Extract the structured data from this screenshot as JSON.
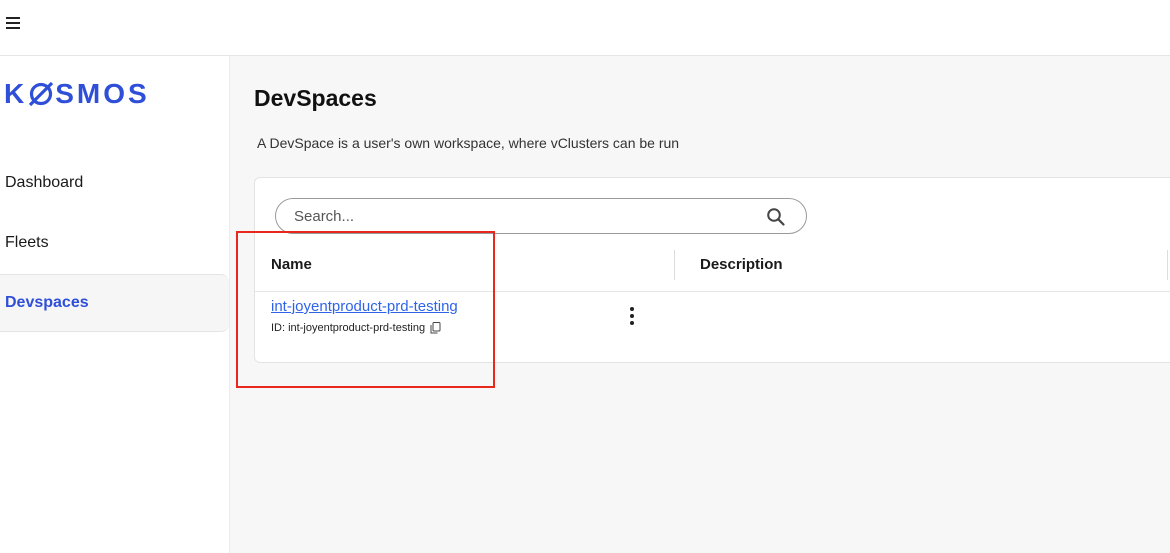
{
  "brand": {
    "logo_text_left": "K",
    "logo_text_right": "SMOS",
    "logo_color": "#2f4fd8"
  },
  "sidebar": {
    "items": [
      {
        "label": "Dashboard",
        "active": false
      },
      {
        "label": "Fleets",
        "active": false
      },
      {
        "label": "Devspaces",
        "active": true
      }
    ]
  },
  "page": {
    "title": "DevSpaces",
    "description": "A DevSpace is a user's own workspace, where vClusters can be run"
  },
  "search": {
    "placeholder": "Search...",
    "value": ""
  },
  "table": {
    "columns": [
      "Name",
      "Description"
    ],
    "rows": [
      {
        "name": "int-joyentproduct-prd-testing",
        "id_text": "ID: int-joyentproduct-prd-testing",
        "description": ""
      }
    ]
  },
  "colors": {
    "accent": "#2f4fd8",
    "link": "#2f64e8",
    "highlight": "#e8281d"
  },
  "icons": [
    "menu-icon",
    "search-icon",
    "copy-icon",
    "kebab-menu-icon"
  ]
}
